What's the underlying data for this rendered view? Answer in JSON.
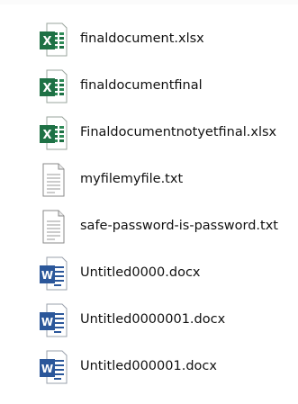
{
  "file_list": {
    "items": [
      {
        "name": "finaldocument.xlsx",
        "icon": "excel-file-icon",
        "icon_letter": "X",
        "icon_color": "#1e7145"
      },
      {
        "name": "finaldocumentfinal",
        "icon": "excel-file-icon",
        "icon_letter": "X",
        "icon_color": "#1e7145"
      },
      {
        "name": "Finaldocumentnotyetfinal.xlsx",
        "icon": "excel-file-icon",
        "icon_letter": "X",
        "icon_color": "#1e7145"
      },
      {
        "name": "myfilemyfile.txt",
        "icon": "text-file-icon"
      },
      {
        "name": "safe-password-is-password.txt",
        "icon": "text-file-icon"
      },
      {
        "name": "Untitled0000.docx",
        "icon": "word-file-icon",
        "icon_letter": "W",
        "icon_color": "#2b579a"
      },
      {
        "name": "Untitled0000001.docx",
        "icon": "word-file-icon",
        "icon_letter": "W",
        "icon_color": "#2b579a"
      },
      {
        "name": "Untitled000001.docx",
        "icon": "word-file-icon",
        "icon_letter": "W",
        "icon_color": "#2b579a"
      }
    ]
  }
}
